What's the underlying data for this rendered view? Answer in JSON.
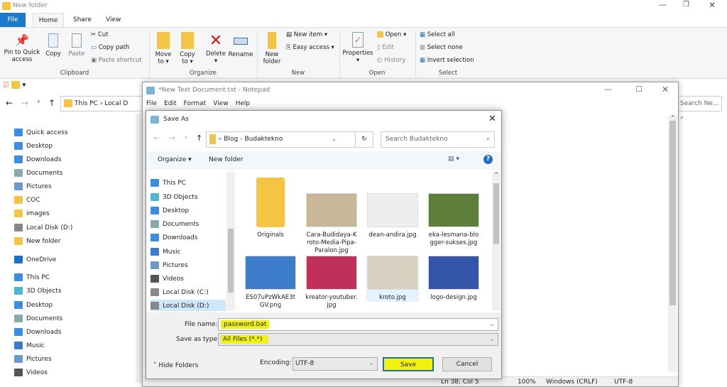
{
  "explorer": {
    "title": "New folder",
    "tabs": [
      "File",
      "Home",
      "Share",
      "View"
    ],
    "ribbon": {
      "pin": "Pin to Quick access",
      "copy": "Copy",
      "paste": "Paste",
      "cut": "Cut",
      "copy_path": "Copy path",
      "paste_shortcut": "Paste shortcut",
      "clipboard": "Clipboard",
      "move_to": "Move to ▾",
      "copy_to": "Copy to ▾",
      "delete": "Delete",
      "rename": "Rename",
      "organize": "Organize",
      "new_folder": "New folder",
      "new_item": "New item ▾",
      "easy_access": "Easy access ▾",
      "new": "New",
      "properties": "Properties",
      "open": "Open ▾",
      "edit": "Edit",
      "history": "History",
      "open_group": "Open",
      "select_all": "Select all",
      "select_none": "Select none",
      "invert_selection": "Invert selection",
      "select": "Select"
    },
    "address": [
      "This PC",
      "Local D"
    ],
    "search_placeholder": "Search Ne...",
    "nav": [
      {
        "label": "Quick access",
        "icon": "star-icon"
      },
      {
        "label": "Desktop",
        "icon": "desktop-icon"
      },
      {
        "label": "Downloads",
        "icon": "download-icon"
      },
      {
        "label": "Documents",
        "icon": "documents-icon"
      },
      {
        "label": "Pictures",
        "icon": "pictures-icon"
      },
      {
        "label": "COC",
        "icon": "folder-icon"
      },
      {
        "label": "images",
        "icon": "folder-icon"
      },
      {
        "label": "Local Disk (D:)",
        "icon": "drive-icon"
      },
      {
        "label": "New folder",
        "icon": "folder-icon"
      },
      {
        "label": "OneDrive",
        "icon": "cloud-icon"
      },
      {
        "label": "This PC",
        "icon": "pc-icon"
      },
      {
        "label": "3D Objects",
        "icon": "cube-icon"
      },
      {
        "label": "Desktop",
        "icon": "desktop-icon"
      },
      {
        "label": "Documents",
        "icon": "documents-icon"
      },
      {
        "label": "Downloads",
        "icon": "download-icon"
      },
      {
        "label": "Music",
        "icon": "music-icon"
      },
      {
        "label": "Pictures",
        "icon": "pictures-icon"
      },
      {
        "label": "Videos",
        "icon": "videos-icon"
      }
    ]
  },
  "notepad": {
    "title": "*New Text Document.txt - Notepad",
    "menu": [
      "File",
      "Edit",
      "Format",
      "View",
      "Help"
    ],
    "status": [
      "Ln 38, Col 5",
      "100%",
      "Windows (CRLF)",
      "UTF-8"
    ]
  },
  "saveas": {
    "title": "Save As",
    "path": [
      "«",
      "Blog",
      "›",
      "Budaktekno"
    ],
    "search_placeholder": "Search Budaktekno",
    "organize": "Organize ▾",
    "new_folder": "New folder",
    "nav": [
      {
        "label": "This PC",
        "icon": "pc-icon"
      },
      {
        "label": "3D Objects",
        "icon": "cube-icon"
      },
      {
        "label": "Desktop",
        "icon": "desktop-icon"
      },
      {
        "label": "Documents",
        "icon": "documents-icon"
      },
      {
        "label": "Downloads",
        "icon": "download-icon"
      },
      {
        "label": "Music",
        "icon": "music-icon"
      },
      {
        "label": "Pictures",
        "icon": "pictures-icon"
      },
      {
        "label": "Videos",
        "icon": "videos-icon"
      },
      {
        "label": "Local Disk (C:)",
        "icon": "drive-icon"
      },
      {
        "label": "Local Disk (D:)",
        "icon": "drive-icon",
        "selected": true
      }
    ],
    "files": [
      {
        "name": "Originals",
        "color": "#f5c443"
      },
      {
        "name": "Cara-Budidaya-Kroto-Media-Pipa-Paralon.jpg",
        "color": "#c9b79a"
      },
      {
        "name": "dean-andira.jpg",
        "color": "#eeeeee"
      },
      {
        "name": "eka-lesmana-blogger-sukses.jpg",
        "color": "#5d7d3a"
      },
      {
        "name": "ES07uPzWkAE3tGV.png",
        "color": "#3d7cc9"
      },
      {
        "name": "kreator-youtuber.jpg",
        "color": "#c0305a"
      },
      {
        "name": "kroto.jpg",
        "color": "#d8cfc0",
        "selected": true
      },
      {
        "name": "logo-design.jpg",
        "color": "#3355aa"
      }
    ],
    "file_name_label": "File name:",
    "file_name": "password.bat",
    "type_label": "Save as type:",
    "type": "All Files  (*.*)",
    "hide_folders": "Hide Folders",
    "encoding_label": "Encoding:",
    "encoding": "UTF-8",
    "save": "Save",
    "cancel": "Cancel"
  },
  "colors": {
    "accent": "#1979ca",
    "highlight": "#f1f20d"
  }
}
